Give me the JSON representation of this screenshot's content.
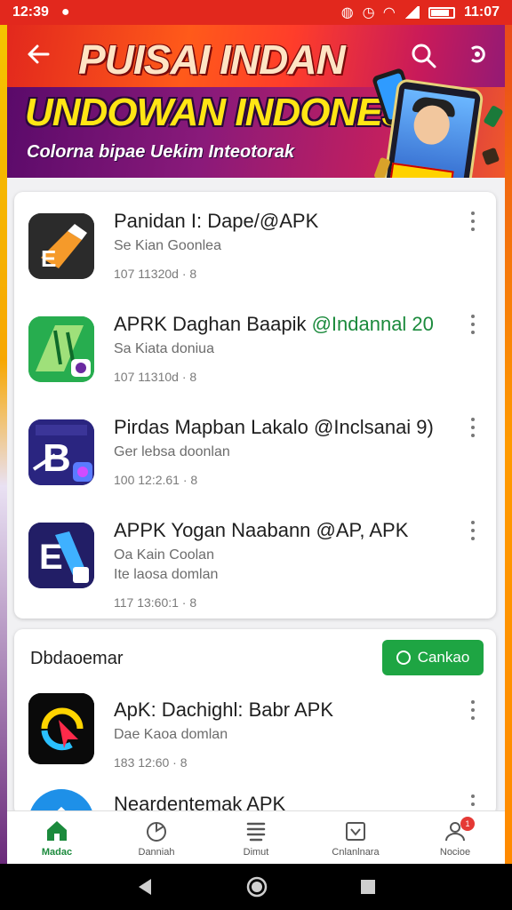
{
  "status_bar": {
    "time": "12:39",
    "clock_right": "11:07"
  },
  "banner": {
    "top_title": "PUISAI INDAN",
    "main_title": "UNDOWAN INDONESIA",
    "subtitle": "Colorna bipae Uekim Inteotorak",
    "colors": {
      "yellow": "#ffe614",
      "red": "#e2281d"
    }
  },
  "apps": [
    {
      "title": "Panidan I: Dape/@APK",
      "highlight": "",
      "publisher": "Se Kian Goonlea",
      "meta": "107 11320d · 8",
      "icon": "pencil-app-icon"
    },
    {
      "title": "APRK Daghan Baapik ",
      "highlight": "@Indannal 20",
      "publisher": "Sa Kiata doniua",
      "meta": "107 11310d · 8",
      "icon": "green-mosque-icon"
    },
    {
      "title": "Pirdas Mapban Lakalo @Inclsanai 9)",
      "highlight": "",
      "publisher": "Ger lebsa doonlan",
      "meta": "100 12:2.61 · 8",
      "icon": "letter-b-app-icon"
    },
    {
      "title": "APPK Yogan Naabann @AP, APK",
      "highlight": "",
      "publisher": "Oa Kain Coolan",
      "publisher2": "Ite laosa domlan",
      "meta": "117 13:60:1 · 8",
      "icon": "document-app-icon"
    }
  ],
  "section": {
    "title": "Dbdaoemar",
    "button_label": "Cankao",
    "apps": [
      {
        "title": "ApK: Dachighl: Babr APK",
        "publisher": "Dae Kaoa domlan",
        "meta": "183 12:60 · 8",
        "icon": "cursor-app-icon"
      },
      {
        "title": "Neardentemak APK",
        "publisher": "",
        "meta": "",
        "icon": "blue-home-app-icon"
      }
    ]
  },
  "bottom_nav": [
    {
      "label": "Madac",
      "icon": "home-icon",
      "active": true
    },
    {
      "label": "Danniah",
      "icon": "apps-icon"
    },
    {
      "label": "Dimut",
      "icon": "list-icon"
    },
    {
      "label": "Cnlanlnara",
      "icon": "library-icon"
    },
    {
      "label": "Nocioe",
      "icon": "profile-icon",
      "badge": "1"
    }
  ]
}
